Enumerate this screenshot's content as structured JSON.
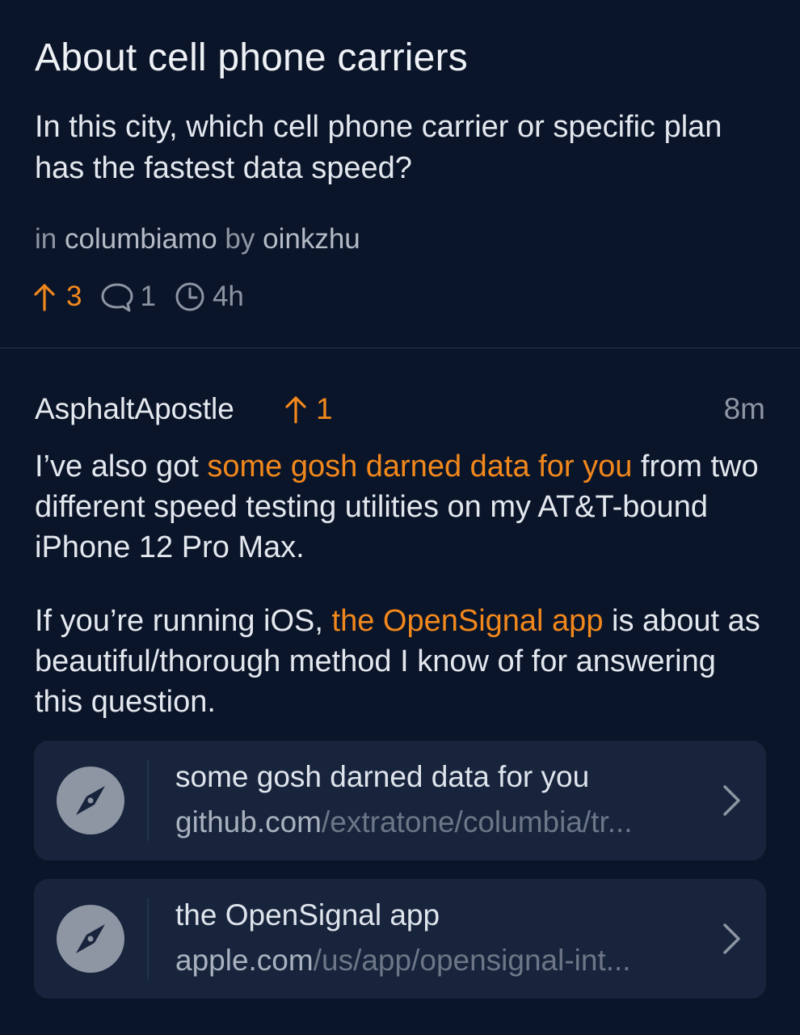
{
  "post": {
    "title": "About cell phone carriers",
    "body": "In this city, which cell phone carrier or specific plan has the fastest data speed?",
    "meta": {
      "in_label": "in",
      "community": "columbiamo",
      "by_label": "by",
      "author": "oinkzhu"
    },
    "stats": {
      "upvotes": "3",
      "comments": "1",
      "age": "4h"
    }
  },
  "comment": {
    "author": "AsphaltApostle",
    "upvotes": "1",
    "time": "8m",
    "paragraph1": {
      "prefix": "I’ve also got ",
      "link": "some gosh darned data for you",
      "suffix": " from two different speed testing utilities on my AT&T-bound iPhone 12 Pro Max."
    },
    "paragraph2": {
      "prefix": "If you’re running iOS, ",
      "link": "the OpenSignal app",
      "suffix": " is about as beautiful/thorough method I know of for answering this question."
    },
    "link_cards": [
      {
        "title": "some gosh darned data for you",
        "domain": "github.com",
        "path": "/extratone/columbia/tr...",
        "icon": "compass-icon"
      },
      {
        "title": "the OpenSignal app",
        "domain": "apple.com",
        "path": "/us/app/opensignal-int...",
        "icon": "compass-icon"
      }
    ]
  },
  "colors": {
    "background": "#0b1529",
    "accent": "#f2881c",
    "card": "#17243c",
    "muted": "#8d95a3"
  }
}
